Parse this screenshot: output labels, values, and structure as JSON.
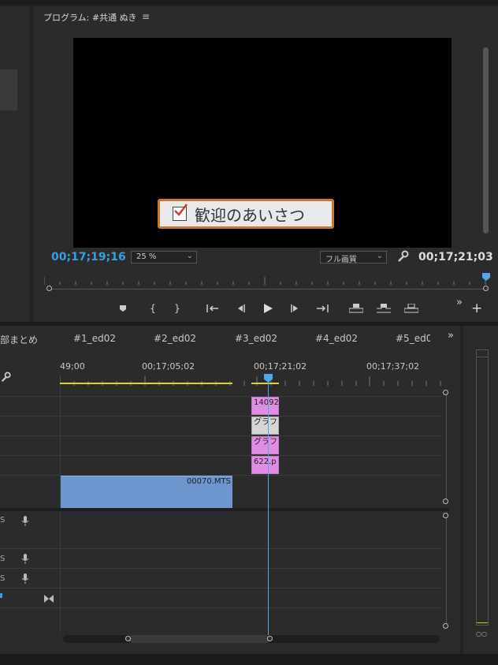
{
  "program": {
    "title": "プログラム: #共通 ぬき",
    "menu_icon": "hamburger-icon",
    "caption_text": "歓迎のあいさつ",
    "current_timecode": "00;17;19;16",
    "zoom": "25 %",
    "quality": "フル画質",
    "duration_timecode": "00;17;21;03",
    "colors": {
      "timecode": "#2fa3e6",
      "playhead": "#4fa8e8",
      "caption_border": "#c87a34"
    }
  },
  "controls": {
    "icons": [
      "marker-icon",
      "mark-in-icon",
      "mark-out-icon",
      "go-to-in-icon",
      "step-back-icon",
      "play-icon",
      "step-forward-icon",
      "go-to-out-icon",
      "lift-icon",
      "extract-icon",
      "export-frame-icon"
    ],
    "more": "»",
    "add": "+"
  },
  "timeline": {
    "tabs": [
      "部まとめ",
      "#1_ed02",
      "#2_ed02",
      "#3_ed02",
      "#4_ed02",
      "#5_ed0"
    ],
    "more": "»",
    "ruler_labels": [
      "49;00",
      "00;17;05;02",
      "00;17;21;02",
      "00;17;37;02"
    ],
    "clips": {
      "v4": "14092",
      "v3": "グラフ",
      "v2": "グラフ",
      "v1": "622.p",
      "video": "00070.MTS"
    },
    "audio_labels": [
      "S",
      "S",
      "S"
    ]
  }
}
